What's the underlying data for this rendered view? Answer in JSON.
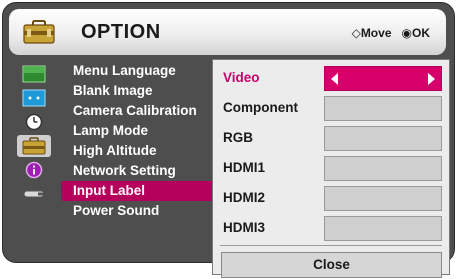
{
  "header": {
    "title": "OPTION",
    "move_hint": "Move",
    "ok_hint": "OK",
    "move_glyph": "◇",
    "ok_glyph": "◉"
  },
  "sidebar_icons": [
    {
      "name": "picture-icon"
    },
    {
      "name": "screen-icon"
    },
    {
      "name": "clock-icon"
    },
    {
      "name": "option-icon",
      "active": true
    },
    {
      "name": "info-icon"
    },
    {
      "name": "usb-icon"
    }
  ],
  "menu": {
    "items": [
      {
        "label": "Menu Language"
      },
      {
        "label": "Blank Image"
      },
      {
        "label": "Camera Calibration"
      },
      {
        "label": "Lamp Mode"
      },
      {
        "label": "High Altitude"
      },
      {
        "label": "Network Setting"
      },
      {
        "label": "Input Label",
        "selected": true
      },
      {
        "label": "Power Sound"
      }
    ]
  },
  "popup": {
    "options": [
      {
        "label": "Video",
        "selected": true
      },
      {
        "label": "Component"
      },
      {
        "label": "RGB"
      },
      {
        "label": "HDMI1"
      },
      {
        "label": "HDMI2"
      },
      {
        "label": "HDMI3"
      }
    ],
    "close_label": "Close"
  },
  "colors": {
    "selection": "#b5005c",
    "popup_accent": "#d8006b",
    "osd_background": "#4e4e4e"
  }
}
